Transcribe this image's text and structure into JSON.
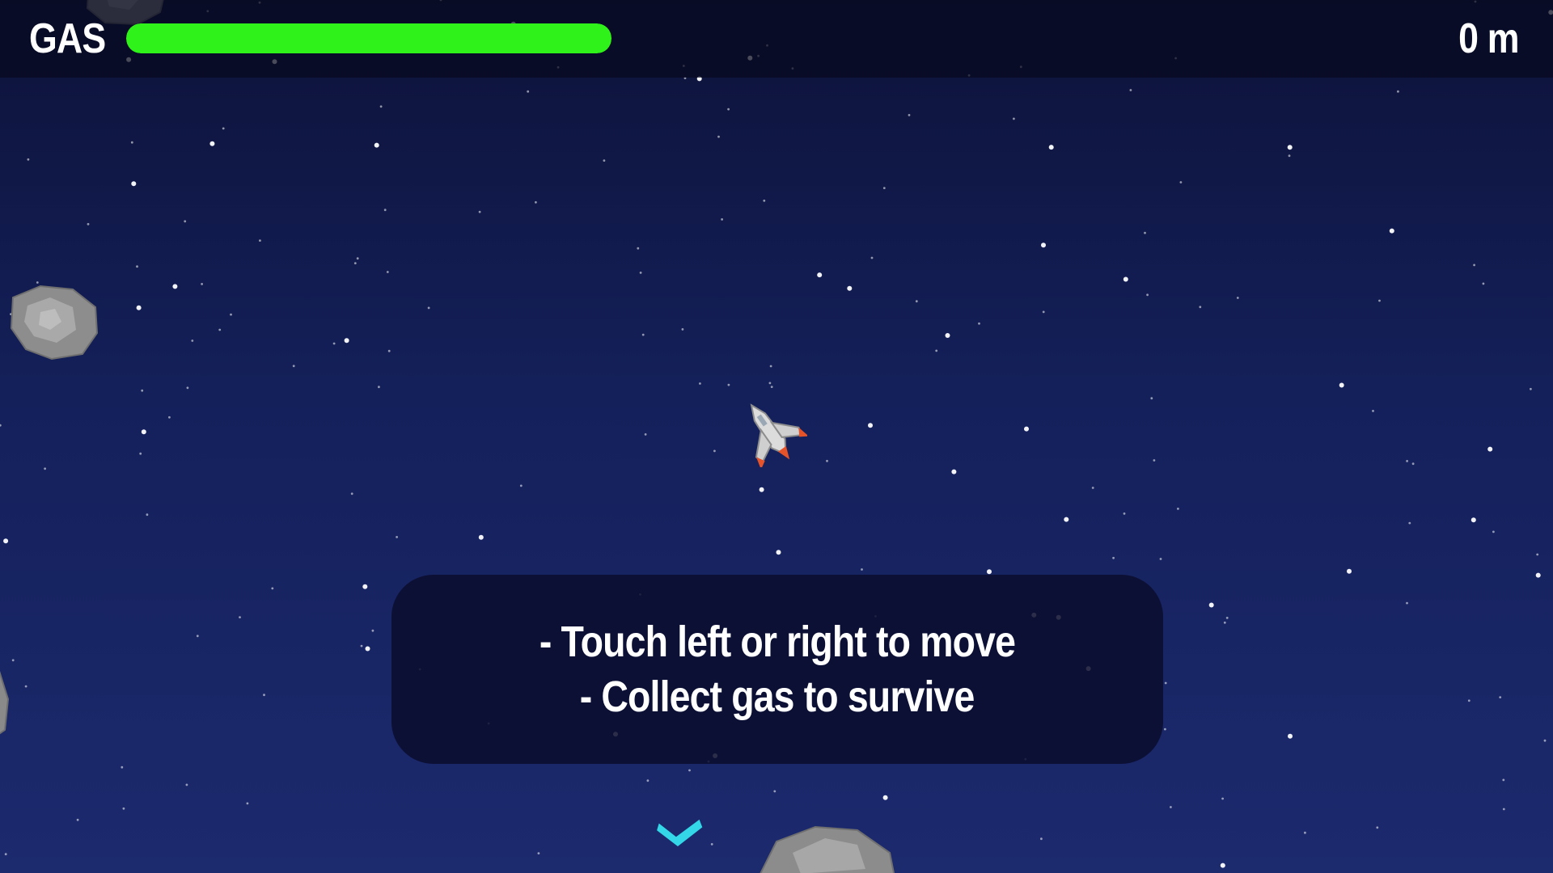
{
  "hud": {
    "gas_label": "GAS",
    "gas_level": 1.0,
    "gas_color": "#2ef21a",
    "distance_text": "0 m"
  },
  "instructions": {
    "line1": "- Touch left or right to move",
    "line2": "- Collect gas to survive"
  },
  "colors": {
    "background_top": "#0d1238",
    "background_bottom": "#1c2a6e",
    "star": "#ffffff",
    "asteroid": "#8c8c8c",
    "ship_body": "#d8d8d8",
    "ship_accent": "#e5532a",
    "pickup": "#33d7e8"
  },
  "sprites": {
    "player": "spaceship",
    "obstacles": "asteroid",
    "pickup": "chevron-pickup"
  }
}
